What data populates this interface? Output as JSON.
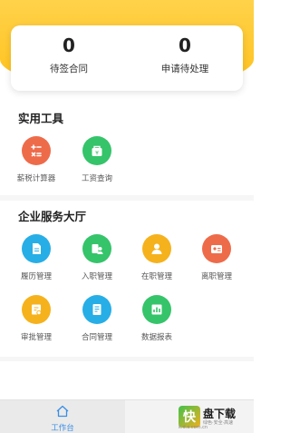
{
  "stats": [
    {
      "value": "0",
      "label": "待签合同"
    },
    {
      "value": "0",
      "label": "申请待处理"
    }
  ],
  "tools": {
    "title": "实用工具",
    "items": [
      {
        "label": "薪税计算器",
        "icon": "calculator-icon",
        "color": "#ee6b4a"
      },
      {
        "label": "工资查询",
        "icon": "salary-wallet-icon",
        "color": "#35c46a"
      }
    ]
  },
  "services": {
    "title": "企业服务大厅",
    "items": [
      {
        "label": "履历管理",
        "icon": "resume-icon",
        "color": "#27aee6"
      },
      {
        "label": "入职管理",
        "icon": "onboarding-icon",
        "color": "#35c46a"
      },
      {
        "label": "在职管理",
        "icon": "employee-icon",
        "color": "#f6b21c"
      },
      {
        "label": "离职管理",
        "icon": "resignation-icon",
        "color": "#ee6b4a"
      },
      {
        "label": "审批管理",
        "icon": "approval-icon",
        "color": "#f6b21c"
      },
      {
        "label": "合同管理",
        "icon": "contract-icon",
        "color": "#27aee6"
      },
      {
        "label": "数据报表",
        "icon": "report-chart-icon",
        "color": "#35c46a"
      }
    ]
  },
  "tabbar": {
    "home_label": "工作台",
    "home_icon": "home-icon",
    "active_color": "#3a8ee6"
  },
  "watermark": {
    "logo_char": "快",
    "main": "盘下载",
    "sub": "绿色·安全·高速",
    "domain": "k.d.a.com.cn"
  },
  "theme": {
    "header_yellow": "#ffc21c"
  }
}
